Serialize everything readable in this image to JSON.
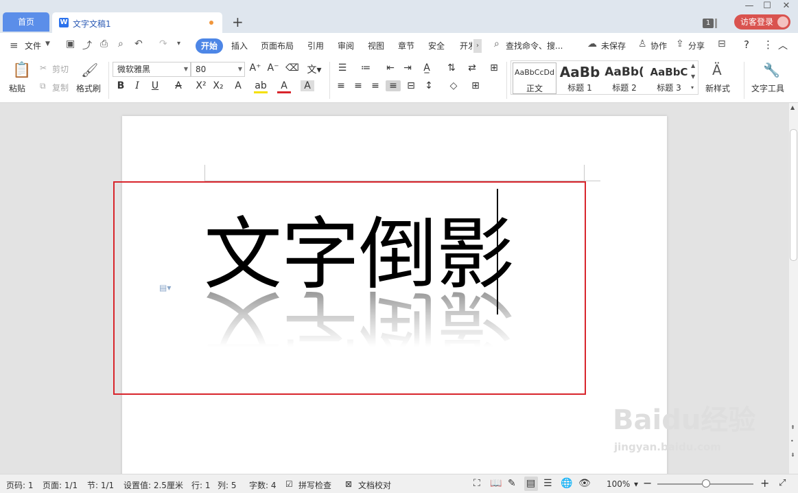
{
  "tabs": {
    "home": "首页",
    "doc": "文字文稿1",
    "doc_icon": "W",
    "new_tab": "+"
  },
  "window": {
    "badge": "1",
    "login": "访客登录",
    "minimize": "—",
    "restore": "☐",
    "close": "✕"
  },
  "menu": {
    "file": "文件",
    "items": [
      "开始",
      "插入",
      "页面布局",
      "引用",
      "审阅",
      "视图",
      "章节",
      "安全",
      "开发"
    ],
    "search": "查找命令、搜...",
    "unsaved": "未保存",
    "collab": "协作",
    "share": "分享",
    "help": "?",
    "more": "⋮",
    "collapse": "︿"
  },
  "ribbon": {
    "paste": "粘贴",
    "cut": "剪切",
    "copy": "复制",
    "format_painter": "格式刷",
    "font_name": "微软雅黑",
    "font_size": "80",
    "styles": [
      {
        "sample": "AaBbCcDd",
        "name": "正文"
      },
      {
        "sample": "AaBb",
        "name": "标题 1"
      },
      {
        "sample": "AaBb(",
        "name": "标题 2"
      },
      {
        "sample": "AaBbC",
        "name": "标题 3"
      }
    ],
    "new_style": "新样式",
    "text_tools": "文字工具",
    "font_buttons": [
      "B",
      "I",
      "U",
      "A",
      "X²",
      "X₂",
      "A",
      "ab",
      "A",
      "A"
    ],
    "grow": "A⁺",
    "shrink": "A⁻"
  },
  "document": {
    "text": "文字倒影"
  },
  "statusbar": {
    "page_code": "页码: 1",
    "pages": "页面: 1/1",
    "section": "节: 1/1",
    "setting": "设置值: 2.5厘米",
    "row": "行: 1",
    "col": "列: 5",
    "words": "字数: 4",
    "spell": "拼写检查",
    "proof": "文档校对",
    "zoom": "100%"
  },
  "watermark": {
    "logo": "Baidu经验",
    "url": "jingyan.baidu.com"
  },
  "colors": {
    "accent": "#4d86e6",
    "highlight": "#d8242b",
    "tab_home": "#5b8ee9"
  }
}
